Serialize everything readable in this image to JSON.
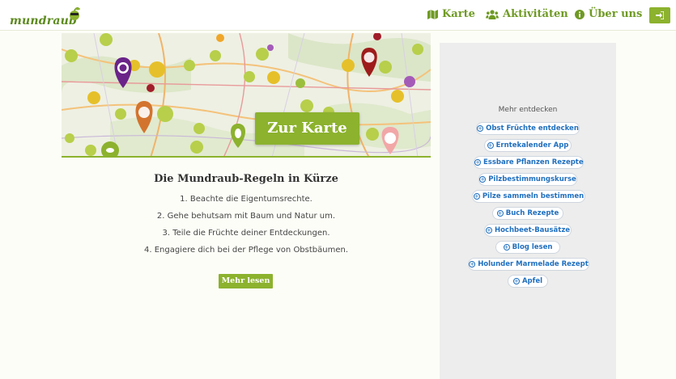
{
  "header": {
    "logo_text": "mundraub",
    "nav": [
      {
        "label": "Karte",
        "icon": "map-icon"
      },
      {
        "label": "Aktivitäten",
        "icon": "users-icon"
      },
      {
        "label": "Über uns",
        "icon": "info-icon"
      }
    ],
    "login_icon": "sign-in-icon"
  },
  "banner": {
    "cta_label": "Zur Karte"
  },
  "rules": {
    "title": "Die Mundraub-Regeln in Kürze",
    "items": [
      "1. Beachte die Eigentumsrechte.",
      "2. Gehe behutsam mit Baum und Natur um.",
      "3. Teile die Früchte deiner Entdeckungen.",
      "4. Engagiere dich bei der Pflege von Obstbäumen."
    ],
    "more_label": "Mehr lesen"
  },
  "sidebar": {
    "title": "Mehr entdecken",
    "links": [
      "Obst Früchte entdecken",
      "Erntekalender App",
      "Essbare Pflanzen Rezepte",
      "Pilzbestimmungskurse",
      "Pilze sammeln bestimmen",
      "Buch Rezepte",
      "Hochbeet-Bausätze",
      "Blog lesen",
      "Holunder Marmelade Rezept",
      "Apfel"
    ]
  },
  "colors": {
    "brand_green": "#8cb22e",
    "link_blue": "#1f6fbf",
    "sidebar_bg": "#ededed"
  }
}
